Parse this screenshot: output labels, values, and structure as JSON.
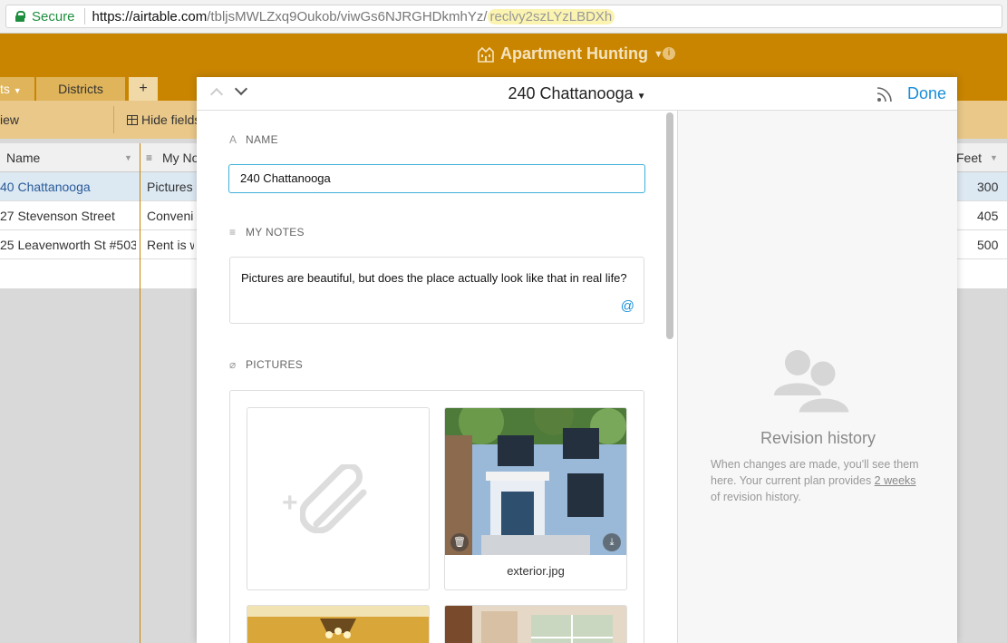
{
  "browser": {
    "secure_label": "Secure",
    "url_base": "https://airtable.com",
    "url_path": "/tbljsMWLZxq9Oukob/viwGs6NJRGHDkmhYz/",
    "url_record": "reclvy2szLYzLBDXh"
  },
  "app": {
    "base_name": "Apartment Hunting",
    "info_icon": "info-icon",
    "tabs": [
      {
        "label": "ts"
      },
      {
        "label": "Districts"
      },
      {
        "label": "+"
      }
    ],
    "view_label": "iew",
    "hide_fields_label": "Hide fields"
  },
  "grid": {
    "headers": {
      "name": "Name",
      "notes": "My No",
      "feet": "Feet"
    },
    "rows": [
      {
        "name": "40 Chattanooga",
        "notes": "Pictures a",
        "feet": "300"
      },
      {
        "name": "27 Stevenson Street",
        "notes": "Convenie",
        "feet": "405"
      },
      {
        "name": "25 Leavenworth St #503",
        "notes": "Rent is wa",
        "feet": "500"
      }
    ]
  },
  "modal": {
    "title": "240 Chattanooga",
    "done_label": "Done",
    "fields": {
      "name_label": "NAME",
      "name_value": "240 Chattanooga",
      "notes_label": "MY NOTES",
      "notes_value": "Pictures are beautiful, but does the place actually look like that in real life?",
      "pictures_label": "PICTURES",
      "picture_file": "exterior.jpg"
    },
    "revision": {
      "title": "Revision history",
      "text_before": "When changes are made, you'll see them here. Your current plan provides ",
      "link": "2 weeks",
      "text_after": " of revision history."
    }
  },
  "colors": {
    "brand": "#c98500",
    "accent": "#1a8ed8",
    "secure": "#1e8e3e"
  }
}
